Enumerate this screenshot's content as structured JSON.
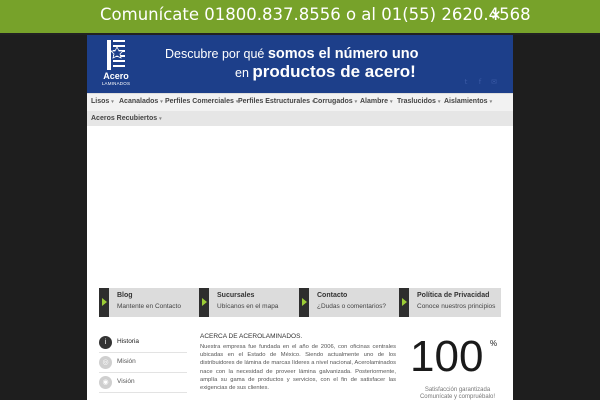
{
  "topbar": {
    "phone_text": "Comunícate 01800.837.8556 o al 01(55) 2620.4568",
    "close_icon": "×"
  },
  "header": {
    "logo": {
      "name": "Acero",
      "subname": "LAMINADOS"
    },
    "slogan": {
      "line1_normal": "Descubre por qué ",
      "line1_bold": "somos el número uno",
      "line2_normal": "en ",
      "line2_bold": "productos de acero!"
    },
    "social_icons": [
      "twitter-icon",
      "facebook-icon",
      "email-icon"
    ]
  },
  "nav": {
    "row1": [
      {
        "label": "Lisos"
      },
      {
        "label": "Acanalados"
      },
      {
        "label": "Perfiles Comerciales"
      },
      {
        "label": "Perfiles Estructurales"
      },
      {
        "label": "Corrugados"
      },
      {
        "label": "Alambre"
      },
      {
        "label": "Traslucidos"
      },
      {
        "label": "Aislamientos"
      }
    ],
    "row2": [
      {
        "label": "Aceros Recubiertos"
      }
    ]
  },
  "features": [
    {
      "title": "Blog",
      "subtitle": "Mantente en Contacto"
    },
    {
      "title": "Sucursales",
      "subtitle": "Ubícanos en el mapa"
    },
    {
      "title": "Contacto",
      "subtitle": "¿Dudas o comentarios?"
    },
    {
      "title": "Política de Privacidad",
      "subtitle": "Conoce nuestros principios"
    }
  ],
  "tabs": [
    {
      "label": "Historia",
      "icon": "info-icon",
      "active": true
    },
    {
      "label": "Misión",
      "icon": "target-icon",
      "active": false
    },
    {
      "label": "Visión",
      "icon": "eye-icon",
      "active": false
    }
  ],
  "about": {
    "title": "ACERCA DE ACEROLAMINADOS.",
    "body": "Nuestra empresa fue fundada en el año de 2006, con oficinas centrales ubicadas en el Estado de México. Siendo actualmente uno de los distribuidores de lámina de marcas líderes a nivel nacional, Acerolaminados nace con la necesidad de proveer lámina galvanizada. Posteriormente, amplía su gama de productos y servicios, con el fin de satisfacer las exigencias de sus clientes."
  },
  "stat": {
    "value": "100",
    "unit": "%",
    "caption1": "Satisfacción garantizada",
    "caption2": "Comunícate y compruébalo!"
  },
  "colors": {
    "topbar_green": "#77a22a",
    "header_blue": "#1d3f8a",
    "accent_green": "#9ccc35"
  }
}
